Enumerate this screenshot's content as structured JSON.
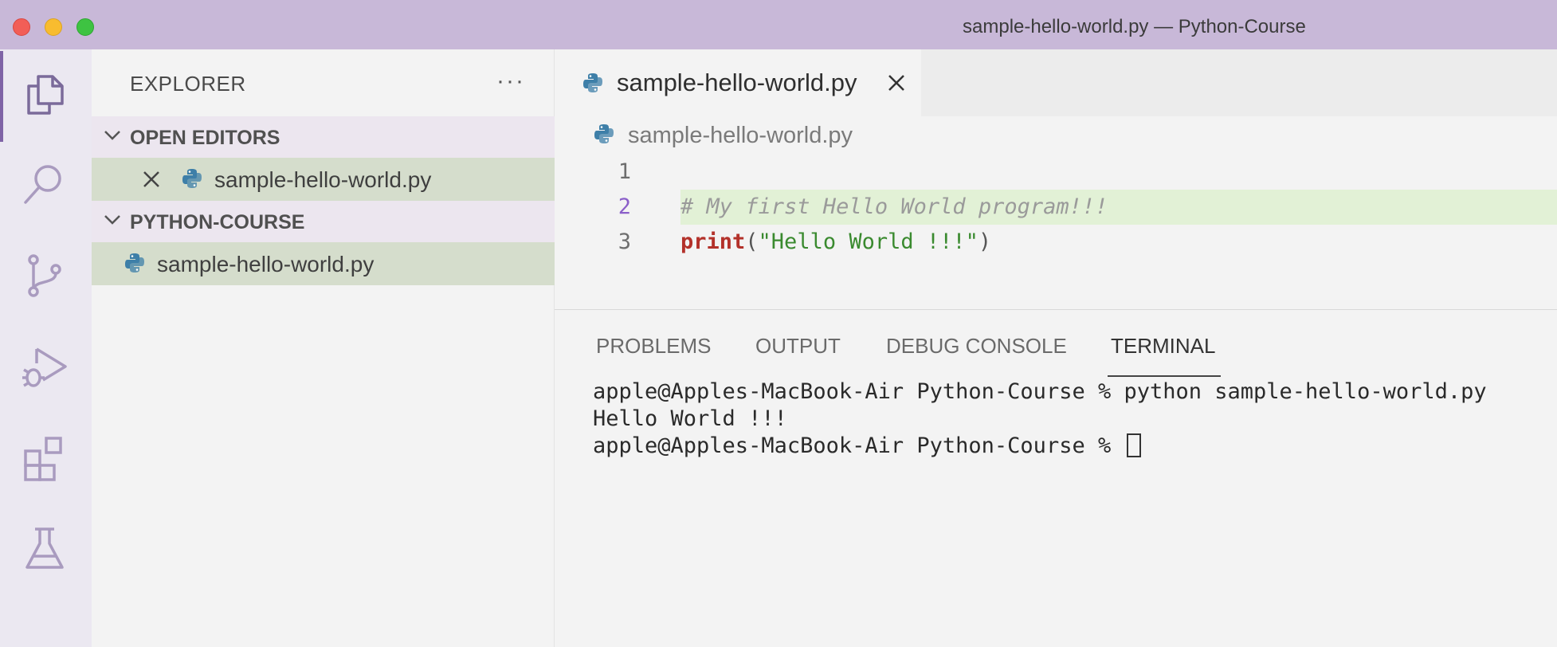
{
  "window": {
    "title": "sample-hello-world.py — Python-Course"
  },
  "activity_bar": {
    "items": [
      {
        "icon": "files-icon"
      },
      {
        "icon": "search-icon"
      },
      {
        "icon": "source-control-icon"
      },
      {
        "icon": "run-debug-icon"
      },
      {
        "icon": "extensions-icon"
      },
      {
        "icon": "testing-flask-icon"
      }
    ]
  },
  "sidebar": {
    "title": "EXPLORER",
    "more": "···",
    "open_editors": {
      "label": "OPEN EDITORS",
      "files": [
        {
          "name": "sample-hello-world.py"
        }
      ]
    },
    "project": {
      "label": "PYTHON-COURSE",
      "files": [
        {
          "name": "sample-hello-world.py"
        }
      ]
    }
  },
  "editor": {
    "tab": {
      "label": "sample-hello-world.py"
    },
    "breadcrumb": "sample-hello-world.py",
    "lines": [
      {
        "num": "1",
        "text": ""
      },
      {
        "num": "2",
        "comment": "# My first Hello World program!!!"
      },
      {
        "num": "3",
        "keyword": "print",
        "open": "(",
        "string": "\"Hello World !!!\"",
        "close": ")"
      }
    ]
  },
  "panel": {
    "tabs": [
      "PROBLEMS",
      "OUTPUT",
      "DEBUG CONSOLE",
      "TERMINAL"
    ],
    "active_tab": "TERMINAL",
    "terminal_lines": [
      "apple@Apples-MacBook-Air Python-Course % python sample-hello-world.py",
      "Hello World !!!",
      "apple@Apples-MacBook-Air Python-Course % "
    ]
  },
  "colors": {
    "titlebar": "#c8b8d8",
    "activity_indicator": "#7f63a6",
    "selection": "#d5ddcc",
    "line_highlight": "#e2f1d6",
    "keyword": "#b3312a",
    "string": "#3a8a2f"
  }
}
